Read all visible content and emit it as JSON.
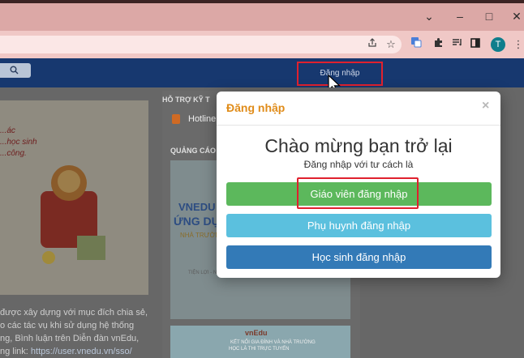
{
  "browser": {
    "avatar_initial": "T",
    "icons": [
      "share-icon",
      "bookmark-star-icon",
      "translate-icon",
      "extensions-icon",
      "reading-list-icon",
      "side-panel-icon",
      "menu-icon"
    ]
  },
  "window_controls": {
    "minimize": "–",
    "maximize": "□",
    "close": "✕"
  },
  "site_nav": {
    "login_label": "Đăng nhập"
  },
  "page": {
    "banner_lines": [
      "...ác",
      "...học sinh",
      "...công."
    ],
    "article_lines": [
      "được xây dựng với mục đích chia sẻ,",
      "o các tác vụ khi sử dụng hệ thống",
      "ng, Bình luận trên Diễn đàn vnEdu,",
      "ng link: "
    ],
    "article_link": "https://user.vnedu.vn/sso/"
  },
  "sidebar": {
    "support_heading": "HỖ TRỢ KỸ T",
    "hotline_label": "Hotline",
    "ads_heading": "QUẢNG CÁO",
    "ad1_lines": [
      "VNEDU C",
      "ỨNG DỤN",
      "NHÀ TRƯỜN",
      "TIỆN LỢI - NHANH"
    ],
    "ad2_lines": [
      "vnEdu",
      "KẾT NỐI GIA ĐÌNH VÀ NHÀ TRƯỜNG",
      "HỌC LÀ THI TRỰC TUYẾN"
    ]
  },
  "modal": {
    "title": "Đăng nhập",
    "close": "×",
    "welcome": "Chào mừng bạn trở lại",
    "subtitle": "Đăng nhập với tư cách là",
    "buttons": {
      "teacher": "Giáo viên đăng nhập",
      "parent": "Phụ huynh đăng nhập",
      "student": "Học sinh đăng nhập"
    }
  },
  "colors": {
    "navbar": "#17386f",
    "modal_title": "#e08c1a",
    "teacher": "#5cb85c",
    "parent": "#5bc0de",
    "student": "#337ab7",
    "highlight": "#e0212e"
  }
}
